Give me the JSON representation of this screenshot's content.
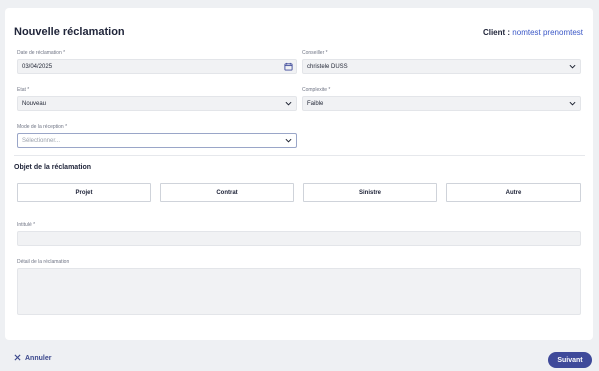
{
  "header": {
    "title": "Nouvelle réclamation",
    "client_label": "Client :",
    "client_name": "nomtest prenomtest"
  },
  "form": {
    "date": {
      "label": "Date de réclamation *",
      "value": "03/04/2025",
      "icon": "calendar-icon"
    },
    "conseiller": {
      "label": "Conseiller *",
      "value": "christele DUSS"
    },
    "etat": {
      "label": "Etat *",
      "value": "Nouveau"
    },
    "complexite": {
      "label": "Complexite *",
      "value": "Faible"
    },
    "mode": {
      "label": "Mode de la réception *",
      "placeholder": "Sélectionner..."
    },
    "intitule": {
      "label": "Intitulé *",
      "value": ""
    },
    "detail": {
      "label": "Détail de la réclamation",
      "value": ""
    }
  },
  "objet": {
    "title": "Objet de la réclamation",
    "options": [
      "Projet",
      "Contrat",
      "Sinistre",
      "Autre"
    ]
  },
  "footer": {
    "cancel_label": "Annuler",
    "submit_label": "Suivant"
  },
  "colors": {
    "accent": "#3f4a9a",
    "client_name": "#3a57c7",
    "field_bg": "#f1f2f4"
  }
}
